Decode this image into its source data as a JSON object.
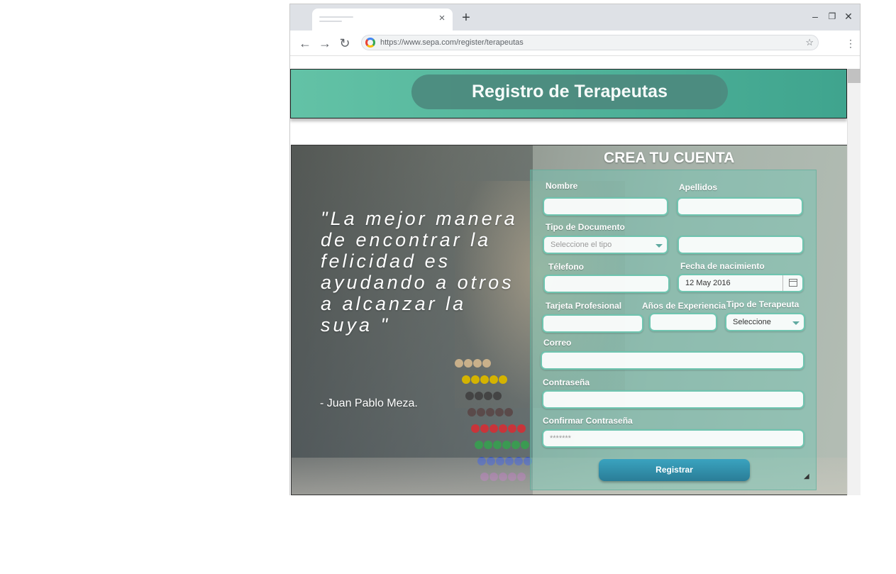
{
  "browser": {
    "url": "https://www.sepa.com/register/terapeutas",
    "new_tab_symbol": "+",
    "tab_close_symbol": "×",
    "minimize_symbol": "–",
    "restore_symbol": "❐",
    "close_symbol": "✕",
    "back_symbol": "←",
    "forward_symbol": "→",
    "reload_symbol": "↻",
    "star_symbol": "☆",
    "menu_symbol": "⋮"
  },
  "header": {
    "title": "Registro de Terapeutas",
    "band_color": "#4fb79c"
  },
  "hero": {
    "quote": "\"La mejor manera de encontrar la felicidad es ayudando a otros a alcanzar la suya \"",
    "author": "- Juan Pablo Meza."
  },
  "form": {
    "title": "CREA TU CUENTA",
    "fields": {
      "nombre_label": "Nombre",
      "apellidos_label": "Apellidos",
      "tipo_documento_label": "Tipo de Documento",
      "tipo_documento_placeholder": "Seleccione el tipo",
      "telefono_label": "Télefono",
      "fecha_label": "Fecha de nacimiento",
      "fecha_value": "12 May 2016",
      "tarjeta_label": "Tarjeta Profesional",
      "anos_label": "Años de Experiencia",
      "tipo_terapeuta_label": "Tipo de Terapeuta",
      "tipo_terapeuta_value": "Seleccione",
      "correo_label": "Correo",
      "contrasena_label": "Contraseña",
      "confirmar_label": "Confirmar Contraseña",
      "confirmar_value": "*******"
    },
    "submit_label": "Registrar",
    "accent_color": "#2f8fa9"
  }
}
